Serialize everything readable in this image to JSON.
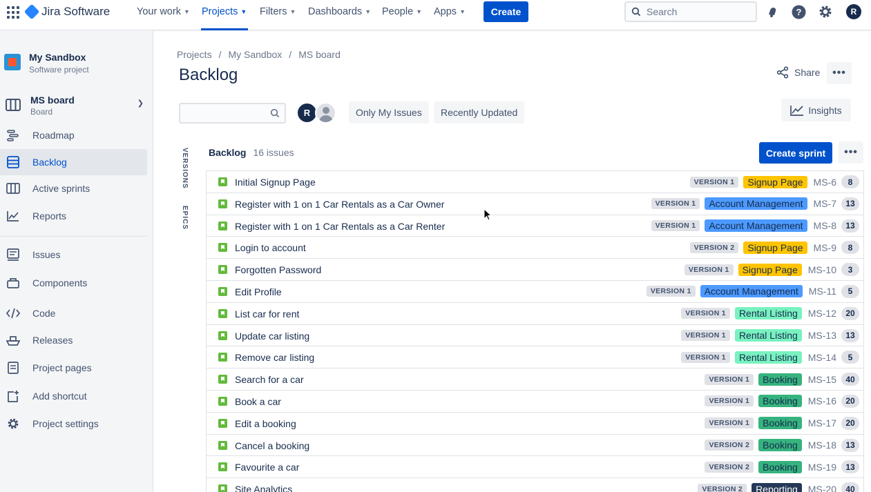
{
  "topnav": {
    "product": "Jira Software",
    "items": [
      {
        "label": "Your work"
      },
      {
        "label": "Projects"
      },
      {
        "label": "Filters"
      },
      {
        "label": "Dashboards"
      },
      {
        "label": "People"
      },
      {
        "label": "Apps"
      }
    ],
    "create_label": "Create",
    "search_placeholder": "Search",
    "avatar_initial": "R"
  },
  "sidebar": {
    "project_name": "My Sandbox",
    "project_type": "Software project",
    "board_name": "MS board",
    "board_type": "Board",
    "items": [
      {
        "label": "Roadmap"
      },
      {
        "label": "Backlog"
      },
      {
        "label": "Active sprints"
      },
      {
        "label": "Reports"
      },
      {
        "label": "Issues"
      },
      {
        "label": "Components"
      },
      {
        "label": "Code"
      },
      {
        "label": "Releases"
      },
      {
        "label": "Project pages"
      },
      {
        "label": "Add shortcut"
      },
      {
        "label": "Project settings"
      }
    ]
  },
  "main": {
    "breadcrumb": [
      "Projects",
      "My Sandbox",
      "MS board"
    ],
    "breadcrumb_sep": "/",
    "title": "Backlog",
    "share_label": "Share",
    "avatar_initial": "R",
    "quick_filters": [
      "Only My Issues",
      "Recently Updated"
    ],
    "insights_label": "Insights",
    "vertical_tabs": [
      "VERSIONS",
      "EPICS"
    ],
    "backlog_title": "Backlog",
    "backlog_count": "16 issues",
    "create_sprint_label": "Create sprint"
  },
  "epic_colors": {
    "Signup Page": {
      "bg": "#ffc400",
      "fg": "#172b4d"
    },
    "Account Management": {
      "bg": "#4c9aff",
      "fg": "#172b4d"
    },
    "Rental Listing": {
      "bg": "#79f2c0",
      "fg": "#172b4d"
    },
    "Booking": {
      "bg": "#36b37e",
      "fg": "#172b4d"
    },
    "Reporting": {
      "bg": "#253858",
      "fg": "#ffffff"
    }
  },
  "issues": [
    {
      "summary": "Initial Signup Page",
      "version": "VERSION 1",
      "epic": "Signup Page",
      "key": "MS-6",
      "estimate": "8"
    },
    {
      "summary": "Register with 1 on 1 Car Rentals as a Car Owner",
      "version": "VERSION 1",
      "epic": "Account Management",
      "key": "MS-7",
      "estimate": "13"
    },
    {
      "summary": "Register with 1 on 1 Car Rentals as a Car Renter",
      "version": "VERSION 1",
      "epic": "Account Management",
      "key": "MS-8",
      "estimate": "13"
    },
    {
      "summary": "Login to account",
      "version": "VERSION 2",
      "epic": "Signup Page",
      "key": "MS-9",
      "estimate": "8"
    },
    {
      "summary": "Forgotten Password",
      "version": "VERSION 1",
      "epic": "Signup Page",
      "key": "MS-10",
      "estimate": "3"
    },
    {
      "summary": "Edit Profile",
      "version": "VERSION 1",
      "epic": "Account Management",
      "key": "MS-11",
      "estimate": "5"
    },
    {
      "summary": "List car for rent",
      "version": "VERSION 1",
      "epic": "Rental Listing",
      "key": "MS-12",
      "estimate": "20"
    },
    {
      "summary": "Update car listing",
      "version": "VERSION 1",
      "epic": "Rental Listing",
      "key": "MS-13",
      "estimate": "13"
    },
    {
      "summary": "Remove car listing",
      "version": "VERSION 1",
      "epic": "Rental Listing",
      "key": "MS-14",
      "estimate": "5"
    },
    {
      "summary": "Search for a car",
      "version": "VERSION 1",
      "epic": "Booking",
      "key": "MS-15",
      "estimate": "40"
    },
    {
      "summary": "Book a car",
      "version": "VERSION 1",
      "epic": "Booking",
      "key": "MS-16",
      "estimate": "20"
    },
    {
      "summary": "Edit a booking",
      "version": "VERSION 1",
      "epic": "Booking",
      "key": "MS-17",
      "estimate": "20"
    },
    {
      "summary": "Cancel a booking",
      "version": "VERSION 2",
      "epic": "Booking",
      "key": "MS-18",
      "estimate": "13"
    },
    {
      "summary": "Favourite a car",
      "version": "VERSION 2",
      "epic": "Booking",
      "key": "MS-19",
      "estimate": "13"
    },
    {
      "summary": "Site Analytics",
      "version": "VERSION 2",
      "epic": "Reporting",
      "key": "MS-20",
      "estimate": "40"
    }
  ]
}
